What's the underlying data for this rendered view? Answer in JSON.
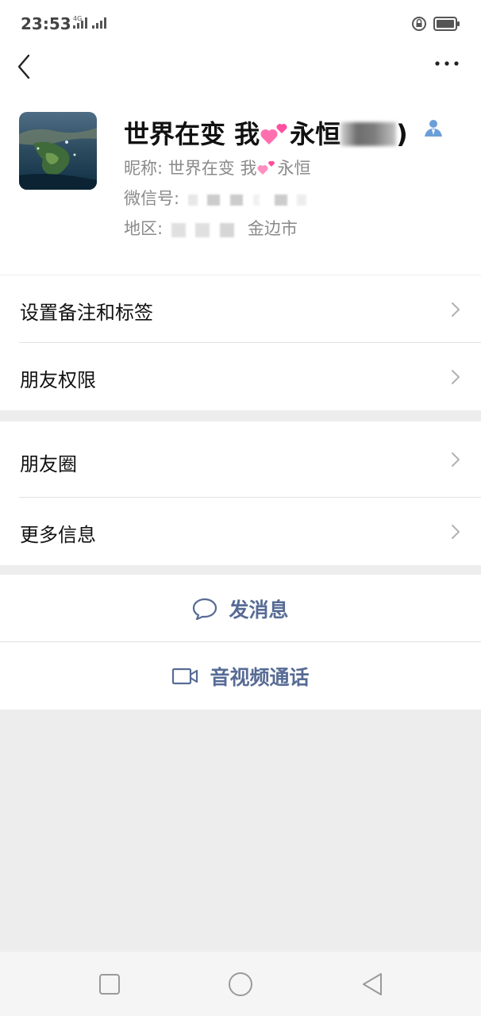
{
  "status_bar": {
    "time": "23:53",
    "network": "4G"
  },
  "profile": {
    "display_name_prefix": "世界在变 我",
    "display_name_mid": "永恒",
    "display_name_suffix": ")",
    "nickname_label": "昵称:",
    "nickname_prefix": "世界在变 我",
    "nickname_suffix": "永恒",
    "wechat_id_label": "微信号:",
    "region_label": "地区:",
    "region_city": "金边市"
  },
  "menu": {
    "group1": [
      {
        "label": "设置备注和标签"
      },
      {
        "label": "朋友权限"
      }
    ],
    "group2": [
      {
        "label": "朋友圈"
      },
      {
        "label": "更多信息"
      }
    ]
  },
  "actions": {
    "send_message": "发消息",
    "video_call": "音视频通话"
  },
  "colors": {
    "accent": "#576b95",
    "background": "#ededed",
    "divider": "#e2e2e2"
  }
}
